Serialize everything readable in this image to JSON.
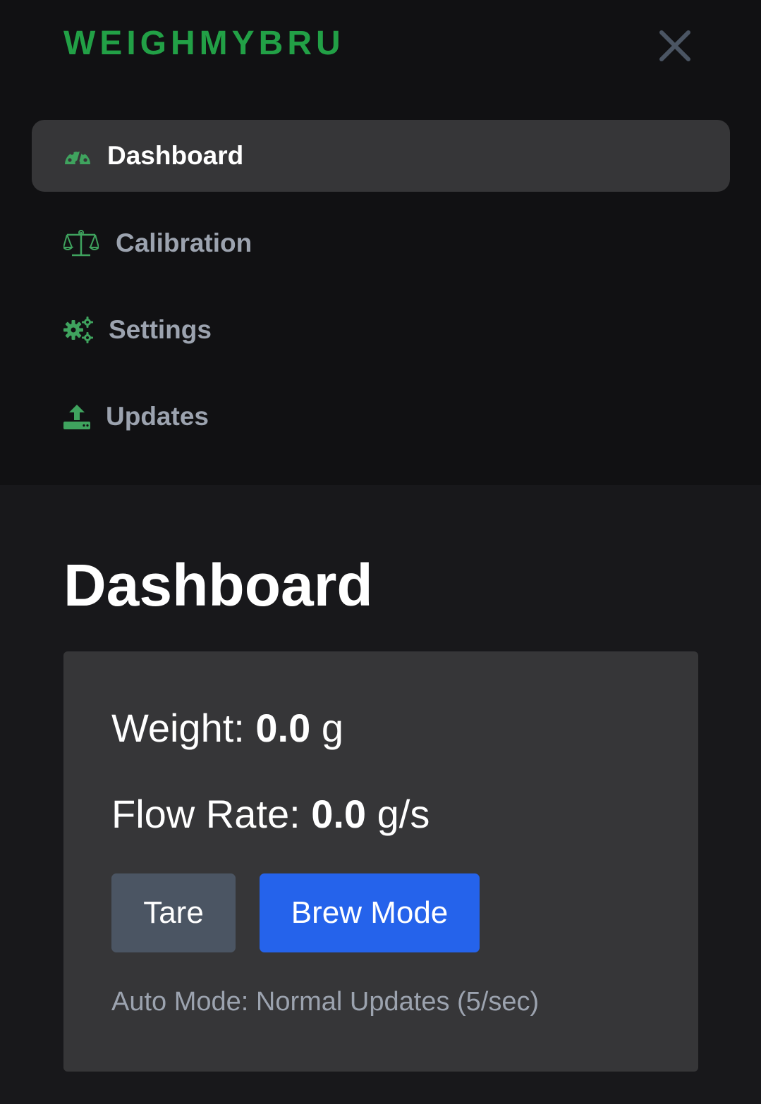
{
  "brand": {
    "name": "WEIGHMYBRU",
    "color": "#22a046"
  },
  "header": {
    "close_icon": "close-icon"
  },
  "sidebar": {
    "items": [
      {
        "label": "Dashboard",
        "icon": "gauge-icon",
        "active": true
      },
      {
        "label": "Calibration",
        "icon": "balance-scale-icon",
        "active": false
      },
      {
        "label": "Settings",
        "icon": "gears-icon",
        "active": false
      },
      {
        "label": "Updates",
        "icon": "upload-icon",
        "active": false
      }
    ]
  },
  "main": {
    "title": "Dashboard",
    "weight": {
      "label": "Weight:",
      "value": "0.0",
      "unit": "g"
    },
    "flow_rate": {
      "label": "Flow Rate:",
      "value": "0.0",
      "unit": "g/s"
    },
    "buttons": {
      "tare": "Tare",
      "brew_mode": "Brew Mode"
    },
    "auto_mode_status": "Auto Mode: Normal Updates (5/sec)"
  },
  "colors": {
    "accent": "#22a046",
    "primary_button": "#2563eb",
    "secondary_button": "#4b5563",
    "nav_background": "#111113",
    "page_background": "#18181b",
    "card_background": "#363638"
  }
}
